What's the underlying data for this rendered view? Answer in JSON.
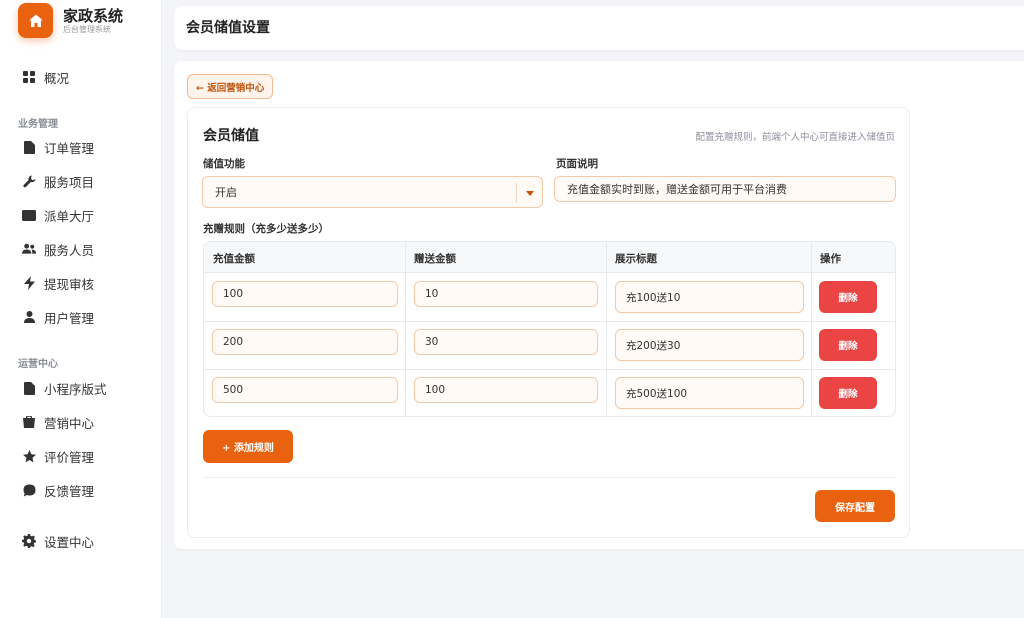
{
  "brand": {
    "title": "家政系统",
    "subtitle": "后台管理系统"
  },
  "sidebar": {
    "top_item": {
      "label": "概况",
      "icon": "grid-icon"
    },
    "sections": [
      {
        "title": "业务管理",
        "items": [
          {
            "label": "订单管理",
            "icon": "document-icon"
          },
          {
            "label": "服务项目",
            "icon": "wrench-icon"
          },
          {
            "label": "派单大厅",
            "icon": "folder-icon"
          },
          {
            "label": "服务人员",
            "icon": "people-icon"
          },
          {
            "label": "提现审核",
            "icon": "bolt-icon"
          },
          {
            "label": "用户管理",
            "icon": "user-icon"
          }
        ]
      },
      {
        "title": "运营中心",
        "items": [
          {
            "label": "小程序版式",
            "icon": "document-icon"
          },
          {
            "label": "营销中心",
            "icon": "shop-icon"
          },
          {
            "label": "评价管理",
            "icon": "star-icon"
          },
          {
            "label": "反馈管理",
            "icon": "chat-icon"
          }
        ]
      }
    ],
    "bottom_item": {
      "label": "设置中心",
      "icon": "gear-icon"
    }
  },
  "header": {
    "title": "会员储值设置"
  },
  "main": {
    "back_label": "← 返回营销中心",
    "card_title": "会员储值",
    "card_hint": "配置充赠规则，前端个人中心可直接进入储值页",
    "function_label": "储值功能",
    "function_value": "开启",
    "desc_label": "页面说明",
    "desc_value": "充值金额实时到账，赠送金额可用于平台消费",
    "rules_label": "充赠规则（充多少送多少）",
    "table": {
      "headers": [
        "充值金额",
        "赠送金额",
        "展示标题",
        "操作"
      ],
      "rows": [
        {
          "recharge": "100",
          "gift": "10",
          "title": "充100送10",
          "action": "删除"
        },
        {
          "recharge": "200",
          "gift": "30",
          "title": "充200送30",
          "action": "删除"
        },
        {
          "recharge": "500",
          "gift": "100",
          "title": "充500送100",
          "action": "删除"
        }
      ]
    },
    "add_label": "+ 添加规则",
    "save_label": "保存配置"
  },
  "colors": {
    "accent": "#e8620f",
    "danger": "#ea4444",
    "input_border": "#f3c9a8"
  }
}
